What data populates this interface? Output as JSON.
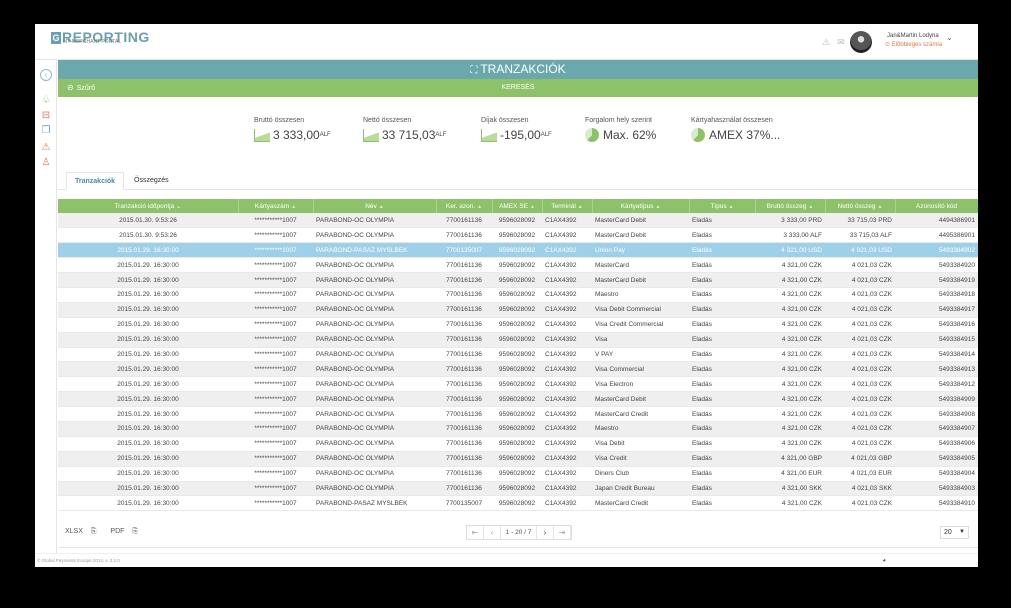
{
  "header": {
    "logo_mark": "G",
    "logo_text": "REPORTING",
    "logo_sub": "MY MERCHANT PORTAL",
    "user_name": "Jan&Martin Lodyna",
    "user_link": "Előbbieges számla",
    "icons": [
      "warning-icon",
      "mail-icon"
    ]
  },
  "sidebar": {
    "items": [
      "back-icon",
      "leaf-icon",
      "cart-icon",
      "documents-icon",
      "alert-icon",
      "user-icon"
    ]
  },
  "title": {
    "icon": "briefcase-icon",
    "label": "TRANZAKCIÓK"
  },
  "filter": {
    "label": "Szűrő",
    "search": "KERESÉS"
  },
  "summary": [
    {
      "label": "Bruttó összesen",
      "value": "3 333,00",
      "unit": "ALF",
      "icon": "area-chart-icon"
    },
    {
      "label": "Nettó összesen",
      "value": "33 715,03",
      "unit": "ALF",
      "icon": "area-chart-icon"
    },
    {
      "label": "Díjak összesen",
      "value": "-195,00",
      "unit": "ALF",
      "icon": "area-chart-icon"
    },
    {
      "label": "Forgalom hely szerint",
      "value": "Max. 62%",
      "unit": "",
      "icon": "pie-chart-icon"
    },
    {
      "label": "Kártyahasználat összesen",
      "value": "AMEX 37%...",
      "unit": "",
      "icon": "pie-chart-icon"
    }
  ],
  "tabs": [
    "Tranzakciók",
    "Összegzés"
  ],
  "table": {
    "columns": [
      "Tranzakció időpontja",
      "Kártyaszám",
      "Név",
      "Ker. azon.",
      "AMEX SE",
      "Terminál",
      "Kártyatípus",
      "Típus",
      "Bruttó összeg",
      "Nettó összeg",
      "Azonosító kód"
    ],
    "rows": [
      [
        "2015.01.30. 9:53:26",
        "***********1007",
        "PARABOND-OC OLYMPIA",
        "7700161136",
        "9596028092",
        "C1AX4392",
        "MasterCard Debit",
        "Eladás",
        "3 333,00 PRD",
        "33 715,03 PRD",
        "4494386901"
      ],
      [
        "2015.01.30. 9:53:26",
        "***********1007",
        "PARABOND-OC OLYMPIA",
        "7700161136",
        "9596028092",
        "C1AX4392",
        "MasterCard Debit",
        "Eladás",
        "3 333,00 ALF",
        "33 715,03 ALF",
        "4495386901"
      ],
      [
        "2015.01.29. 16:30:00",
        "***********1007",
        "PARABOND-PASAZ MYSLBEK",
        "7700135007",
        "9596028092",
        "C1AX4392",
        "Union Pay",
        "Eladás",
        "4 321,00 USD",
        "4 021,03 USD",
        "5493384902"
      ],
      [
        "2015.01.29. 16:30:00",
        "***********1007",
        "PARABOND-OC OLYMPIA",
        "7700161136",
        "9596028092",
        "C1AX4392",
        "MasterCard",
        "Eladás",
        "4 321,00 CZK",
        "4 021,03 CZK",
        "5493384920"
      ],
      [
        "2015.01.29. 16:30:00",
        "***********1007",
        "PARABOND-OC OLYMPIA",
        "7700161136",
        "9596028092",
        "C1AX4392",
        "MasterCard Debit",
        "Eladás",
        "4 321,00 CZK",
        "4 021,03 CZK",
        "5493384919"
      ],
      [
        "2015.01.29. 16:30:00",
        "***********1007",
        "PARABOND-OC OLYMPIA",
        "7700161136",
        "9596028092",
        "C1AX4392",
        "Maestro",
        "Eladás",
        "4 321,00 CZK",
        "4 021,03 CZK",
        "5493384918"
      ],
      [
        "2015.01.29. 16:30:00",
        "***********1007",
        "PARABOND-OC OLYMPIA",
        "7700161136",
        "9596028092",
        "C1AX4392",
        "Visa Debit Commercial",
        "Eladás",
        "4 321,00 CZK",
        "4 021,03 CZK",
        "5493384917"
      ],
      [
        "2015.01.29. 16:30:00",
        "***********1007",
        "PARABOND-OC OLYMPIA",
        "7700161136",
        "9596028092",
        "C1AX4392",
        "Visa Credit Commercial",
        "Eladás",
        "4 321,00 CZK",
        "4 021,03 CZK",
        "5493384916"
      ],
      [
        "2015.01.29. 16:30:00",
        "***********1007",
        "PARABOND-OC OLYMPIA",
        "7700161136",
        "9596028092",
        "C1AX4392",
        "Visa",
        "Eladás",
        "4 321,00 CZK",
        "4 021,03 CZK",
        "5493384915"
      ],
      [
        "2015.01.29. 16:30:00",
        "***********1007",
        "PARABOND-OC OLYMPIA",
        "7700161136",
        "9596028092",
        "C1AX4392",
        "V PAY",
        "Eladás",
        "4 321,00 CZK",
        "4 021,03 CZK",
        "5493384914"
      ],
      [
        "2015.01.29. 16:30:00",
        "***********1007",
        "PARABOND-OC OLYMPIA",
        "7700161136",
        "9596028092",
        "C1AX4392",
        "Visa Commercial",
        "Eladás",
        "4 321,00 CZK",
        "4 021,03 CZK",
        "5493384913"
      ],
      [
        "2015.01.29. 16:30:00",
        "***********1007",
        "PARABOND-OC OLYMPIA",
        "7700161136",
        "9596028092",
        "C1AX4392",
        "Visa Electron",
        "Eladás",
        "4 321,00 CZK",
        "4 021,03 CZK",
        "5493384912"
      ],
      [
        "2015.01.29. 16:30:00",
        "***********1007",
        "PARABOND-OC OLYMPIA",
        "7700161136",
        "9596028092",
        "C1AX4392",
        "MasterCard Debit",
        "Eladás",
        "4 321,00 CZK",
        "4 021,03 CZK",
        "5493384909"
      ],
      [
        "2015.01.29. 16:30:00",
        "***********1007",
        "PARABOND-OC OLYMPIA",
        "7700161136",
        "9596028092",
        "C1AX4392",
        "MasterCard Credit",
        "Eladás",
        "4 321,00 CZK",
        "4 021,03 CZK",
        "5493384908"
      ],
      [
        "2015.01.29. 16:30:00",
        "***********1007",
        "PARABOND-OC OLYMPIA",
        "7700161136",
        "9596028092",
        "C1AX4392",
        "Maestro",
        "Eladás",
        "4 321,00 CZK",
        "4 021,03 CZK",
        "5493384907"
      ],
      [
        "2015.01.29. 16:30:00",
        "***********1007",
        "PARABOND-OC OLYMPIA",
        "7700161136",
        "9596028092",
        "C1AX4392",
        "Visa Debit",
        "Eladás",
        "4 321,00 CZK",
        "4 021,03 CZK",
        "5493384906"
      ],
      [
        "2015.01.29. 16:30:00",
        "***********1007",
        "PARABOND-OC OLYMPIA",
        "7700161136",
        "9596028092",
        "C1AX4392",
        "Visa Credit",
        "Eladás",
        "4 321,00 GBP",
        "4 021,03 GBP",
        "5493384905"
      ],
      [
        "2015.01.29. 16:30:00",
        "***********1007",
        "PARABOND-OC OLYMPIA",
        "7700161136",
        "9596028092",
        "C1AX4392",
        "Diners Club",
        "Eladás",
        "4 321,00 EUR",
        "4 021,03 EUR",
        "5493384904"
      ],
      [
        "2015.01.29. 16:30:00",
        "***********1007",
        "PARABOND-OC OLYMPIA",
        "7700161136",
        "9596028092",
        "C1AX4392",
        "Japan Credit Bureau",
        "Eladás",
        "4 321,00 SKK",
        "4 021,03 SKK",
        "5493384903"
      ],
      [
        "2015.01.29. 16:30:00",
        "***********1007",
        "PARABOND-PASAZ MYSLBEK",
        "7700135007",
        "9596028092",
        "C1AX4392",
        "MasterCard Credit",
        "Eladás",
        "4 321,00 CZK",
        "4 021,03 CZK",
        "5493384910"
      ]
    ],
    "selected_row": 2
  },
  "footer": {
    "xlsx": "XLSX",
    "pdf": "PDF",
    "pager_info": "1 - 20 / 7",
    "per_page": "20",
    "copyright": "© Global Payments Europe 2014, v. 2.2.0"
  },
  "colors": {
    "teal": "#6aa8ae",
    "green": "#8ec26a",
    "selected": "#9fd0ea",
    "accent": "#4a8aa6"
  }
}
